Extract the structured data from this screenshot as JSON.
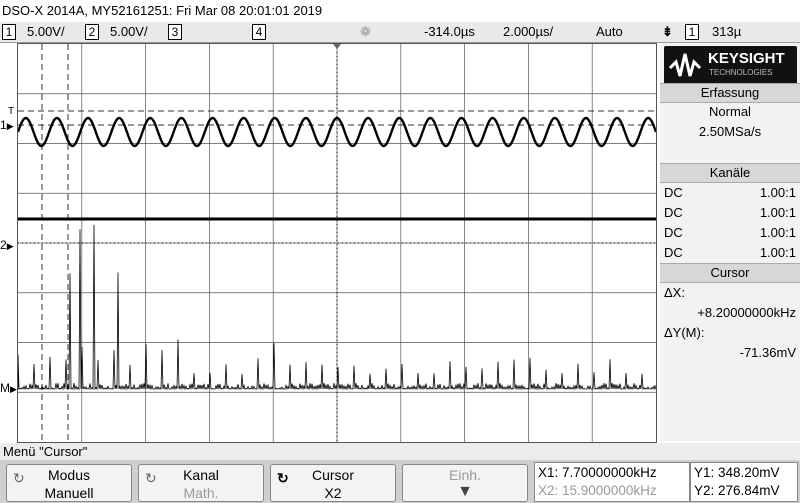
{
  "title": "DSO-X 2014A, MY52161251: Fri Mar 08 20:01:01 2019",
  "statusbar": {
    "ch1_num": "1",
    "ch1_scale": "5.00V/",
    "ch2_num": "2",
    "ch2_scale": "5.00V/",
    "ch3_num": "3",
    "ch4_num": "4",
    "delay": "-314.0µs",
    "timebase": "2.000µs/",
    "trigger_mode": "Auto",
    "trigger_source": "1",
    "trigger_level": "313µ"
  },
  "side": {
    "logo_name": "KEYSIGHT",
    "logo_sub": "TECHNOLOGIES",
    "acq_header": "Erfassung",
    "acq_mode": "Normal",
    "acq_rate": "2.50MSa/s",
    "channels_header": "Kanäle",
    "channels": [
      {
        "coupling": "DC",
        "probe": "1.00:1"
      },
      {
        "coupling": "DC",
        "probe": "1.00:1"
      },
      {
        "coupling": "DC",
        "probe": "1.00:1"
      },
      {
        "coupling": "DC",
        "probe": "1.00:1"
      }
    ],
    "cursor_header": "Cursor",
    "dx_label": "ΔX:",
    "dx_value": "+8.20000000kHz",
    "dy_label": "ΔY(M):",
    "dy_value": "-71.36mV"
  },
  "menu_title": "Menü \"Cursor\"",
  "softkeys": [
    {
      "top": "Modus",
      "bottom": "Manuell"
    },
    {
      "top": "Kanal",
      "bottom": "Math."
    },
    {
      "top": "Cursor",
      "bottom": "X2"
    },
    {
      "top": "Einh."
    }
  ],
  "readout": {
    "x1": "X1: 7.70000000kHz",
    "x2": "X2: 15.9000000kHz",
    "y1": "Y1: 348.20mV",
    "y2": "Y2: 276.84mV"
  },
  "markers": {
    "ch1": "1",
    "ch2": "2",
    "math": "M",
    "trig": "T"
  },
  "colors": {
    "trace": "#000000",
    "grid": "#555555",
    "accent": "#ffffff"
  }
}
